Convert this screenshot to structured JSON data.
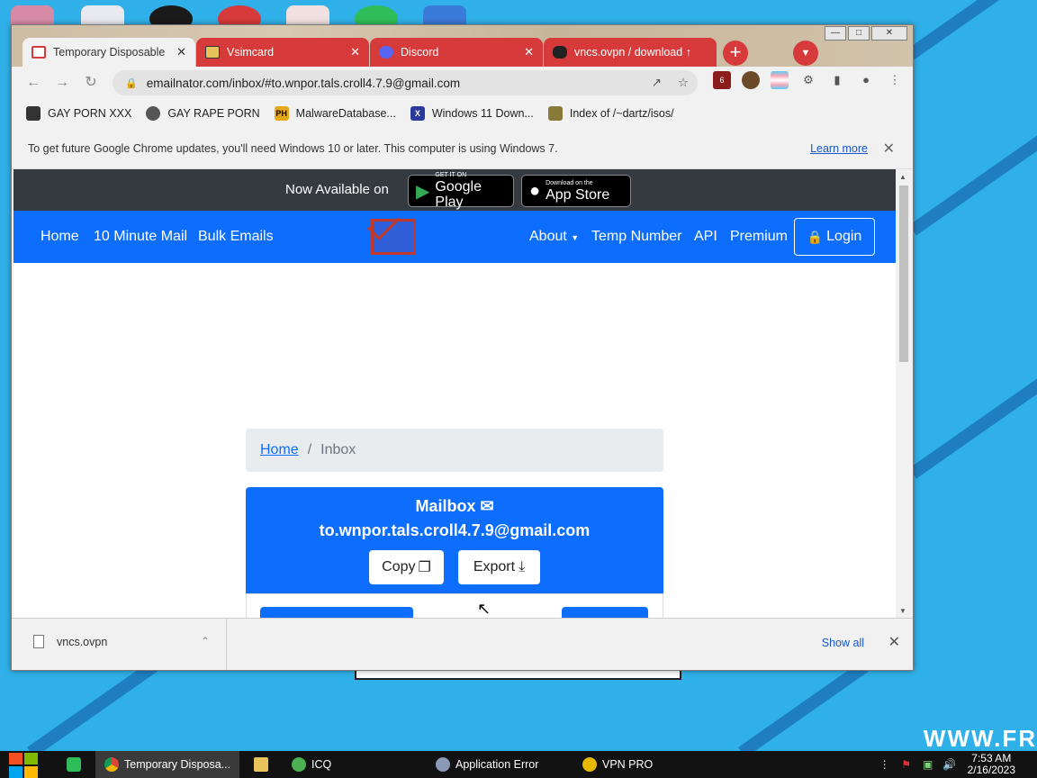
{
  "browser": {
    "tabs": [
      {
        "title": "Temporary Disposable",
        "active": true,
        "favicon_color": "#d63a3a"
      },
      {
        "title": "Vsimcard",
        "active": false,
        "favicon_color": "#e6c35a"
      },
      {
        "title": "Discord",
        "active": false,
        "favicon_color": "#5865f2"
      },
      {
        "title": "vncs.ovpn / download ↑",
        "active": false,
        "favicon_color": "#222222"
      }
    ],
    "new_tab_icon": "+",
    "address": "emailnator.com/inbox/#to.wnpor.tals.croll4.7.9@gmail.com",
    "extension_badge": "6",
    "bookmarks": [
      {
        "label": "GAY PORN XXX",
        "icon_color": "#333333",
        "icon_text": ""
      },
      {
        "label": "GAY RAPE PORN",
        "icon_color": "#555555",
        "icon_text": ""
      },
      {
        "label": "MalwareDatabase...",
        "icon_color": "#e6a817",
        "icon_text": "PH"
      },
      {
        "label": "Windows 11 Down...",
        "icon_color": "#2a3a9a",
        "icon_text": "X"
      },
      {
        "label": "Index of /~dartz/isos/",
        "icon_color": "#8a7a3a",
        "icon_text": ""
      }
    ],
    "infobar": {
      "message": "To get future Google Chrome updates, you'll need Windows 10 or later. This computer is using Windows 7.",
      "link": "Learn more"
    },
    "downloads": {
      "file": "vncs.ovpn",
      "show_all": "Show all"
    }
  },
  "page": {
    "promo": {
      "label": "Now Available on",
      "google_small": "GET IT ON",
      "google_large": "Google Play",
      "apple_small": "Download on the",
      "apple_large": "App Store"
    },
    "nav": {
      "left": [
        "Home",
        "10 Minute Mail",
        "Bulk Emails"
      ],
      "about": "About",
      "temp_number": "Temp Number",
      "api": "API",
      "premium": "Premium",
      "login": "Login"
    },
    "breadcrumb": {
      "home": "Home",
      "separator": "/",
      "current": "Inbox"
    },
    "mailbox": {
      "title": "Mailbox",
      "address": "to.wnpor.tals.croll4.7.9@gmail.com",
      "copy": "Copy",
      "export": "Export"
    }
  },
  "taskbar": {
    "items": [
      "Temporary Disposa...",
      "ICQ",
      "Application Error",
      "VPN PRO"
    ],
    "time": "7:53 AM",
    "date": "2/16/2023"
  },
  "desktop": {
    "watermark": "WWW.FR"
  },
  "colors": {
    "accent_blue": "#0d6efd",
    "tab_red": "#d63a3a",
    "promo_dark": "#343a40"
  }
}
